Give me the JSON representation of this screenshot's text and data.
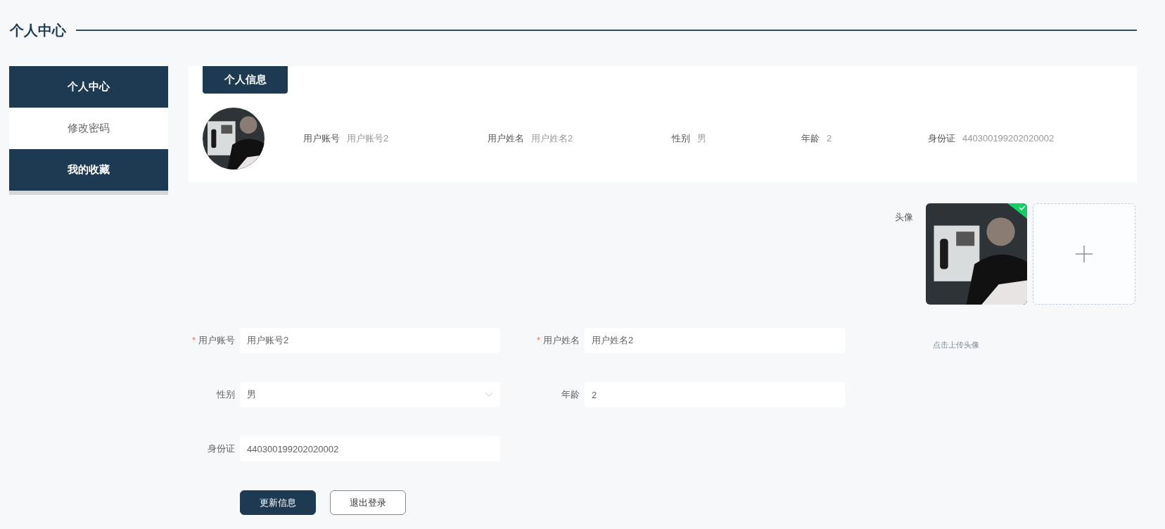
{
  "page_title": "个人中心",
  "sidebar": {
    "items": [
      {
        "label": "个人中心",
        "active": true
      },
      {
        "label": "修改密码",
        "active": false
      },
      {
        "label": "我的收藏",
        "active": true
      }
    ]
  },
  "info_card": {
    "tab": "个人信息",
    "fields": [
      {
        "label": "用户账号",
        "value": "用户账号2"
      },
      {
        "label": "用户姓名",
        "value": "用户姓名2"
      },
      {
        "label": "性别",
        "value": "男"
      },
      {
        "label": "年龄",
        "value": "2"
      },
      {
        "label": "身份证",
        "value": "440300199202020002"
      }
    ]
  },
  "avatar_upload": {
    "label": "头像",
    "uploaded": true,
    "hint": "点击上传头像"
  },
  "form": {
    "rows": [
      [
        {
          "label": "用户账号",
          "required_mark": "*",
          "kind": "input",
          "value": "用户账号2"
        },
        {
          "label": "用户姓名",
          "required_mark": "*",
          "kind": "input",
          "value": "用户姓名2"
        }
      ],
      [
        {
          "label": "性别",
          "kind": "select",
          "value": "男"
        },
        {
          "label": "年龄",
          "kind": "input",
          "value": "2"
        }
      ],
      [
        {
          "label": "身份证",
          "kind": "input",
          "value": "440300199202020002"
        }
      ]
    ],
    "buttons": [
      {
        "label": "更新信息",
        "kind": "primary"
      },
      {
        "label": "退出登录",
        "kind": "outline"
      }
    ]
  }
}
